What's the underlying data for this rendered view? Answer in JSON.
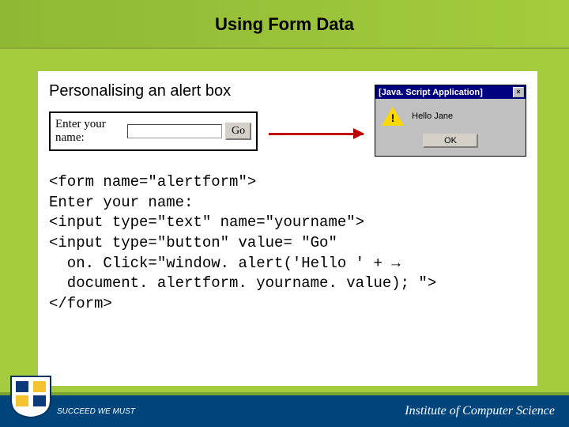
{
  "header": {
    "title": "Using Form Data"
  },
  "subhead": "Personalising an alert box",
  "form_demo": {
    "label": "Enter your name:",
    "go": "Go"
  },
  "dialog": {
    "title": "[Java. Script Application]",
    "close": "×",
    "message": "Hello Jane",
    "ok": "OK"
  },
  "code": {
    "l1": "<form name=\"alertform\">",
    "l2": "Enter your name:",
    "l3": "<input type=\"text\" name=\"yourname\">",
    "l4": "<input type=\"button\" value= \"Go\"",
    "l5": "  on. Click=\"window. alert('Hello ' + →",
    "l6": "  document. alertform. yourname. value); \">",
    "l7": "</form>"
  },
  "footer": {
    "motto": "SUCCEED WE MUST",
    "institute": "Institute of Computer Science"
  }
}
